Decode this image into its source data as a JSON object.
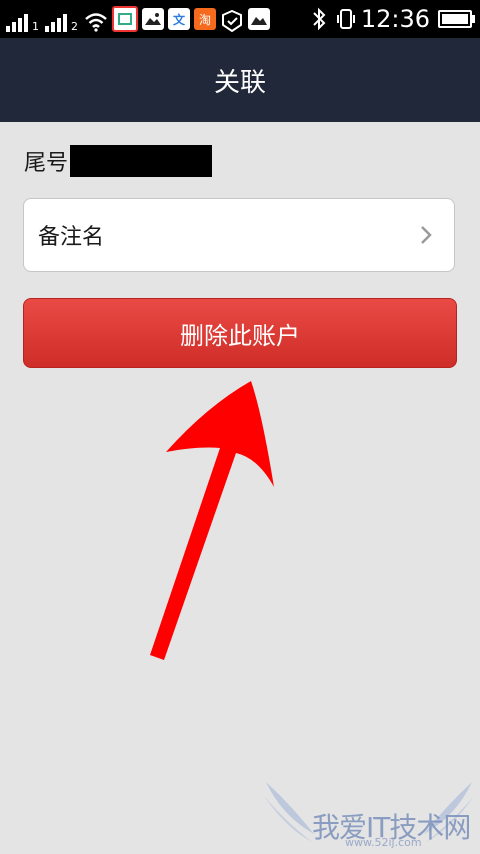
{
  "status_bar": {
    "time": "12:36",
    "sim1": "1",
    "sim2": "2",
    "icons": [
      "signal-icon",
      "wifi-icon",
      "photo-app-icon",
      "gallery-icon",
      "translate-app-icon",
      "taobao-app-icon",
      "notification-icon",
      "image-app-icon",
      "bluetooth-icon",
      "vibrate-icon",
      "battery-icon"
    ],
    "taobao_glyph": "淘",
    "translate_glyph": "文"
  },
  "header": {
    "title": "关联"
  },
  "account": {
    "label": "尾号"
  },
  "remark": {
    "label": "备注名"
  },
  "delete_button": {
    "label": "删除此账户"
  },
  "annotation": {
    "arrow_color": "#ff0000"
  },
  "watermark": {
    "text": "我爱IT技术网",
    "url": "www.52ij.com"
  },
  "colors": {
    "header_bg": "#21283a",
    "page_bg": "#e4e4e4",
    "danger": "#dc3b35"
  }
}
